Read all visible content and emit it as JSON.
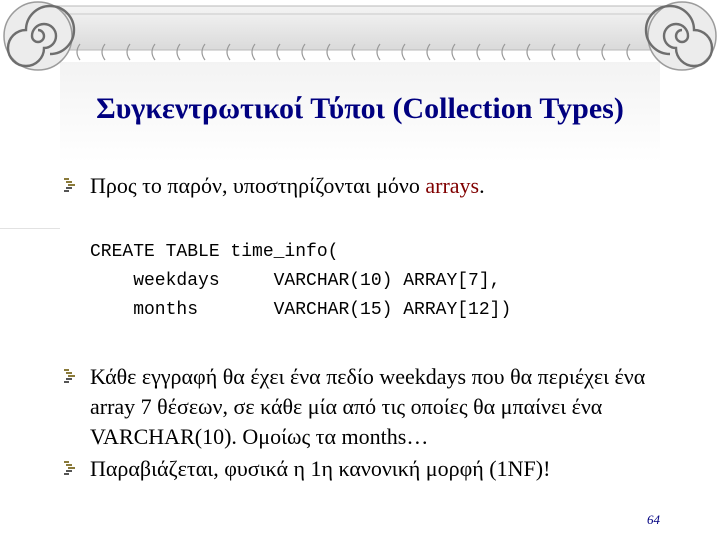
{
  "slide": {
    "title": "Συγκεντρωτικοί Τύποι (Collection Types)",
    "bullet1": {
      "text": "Προς το παρόν, υποστηρίζονται μόνο ",
      "highlight": "arrays",
      "suffix": "."
    },
    "code_lines": [
      "CREATE TABLE time_info(",
      "    weekdays     VARCHAR(10) ARRAY[7],",
      "    months       VARCHAR(15) ARRAY[12])"
    ],
    "bullet2": "Κάθε εγγραφή θα έχει ένα πεδίο weekdays που θα περιέχει ένα array 7 θέσεων, σε κάθε μία από τις οποίες θα μπαίνει ένα VARCHAR(10). Ομοίως τα months…",
    "bullet3": "Παραβιάζεται, φυσικά η 1η κανονική μορφή (1NF)!",
    "page_number": "64",
    "colors": {
      "title": "#000080",
      "highlight": "#800000",
      "page_number": "#000080"
    },
    "icons": {
      "bullet": "stepped-bar-bullet-icon",
      "header": "ionic-volute-icon"
    }
  }
}
